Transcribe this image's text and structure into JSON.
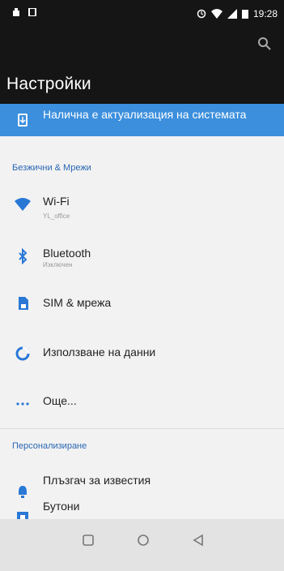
{
  "status": {
    "time": "19:28"
  },
  "header": {
    "title": "Настройки"
  },
  "banner": {
    "text": "Налична е актуализация на системата"
  },
  "sections": {
    "wireless": "Безжични & Мрежи",
    "personal": "Персонализиране"
  },
  "items": {
    "wifi": {
      "label": "Wi-Fi",
      "sub": "YL_office"
    },
    "bluetooth": {
      "label": "Bluetooth",
      "sub": "Изключен"
    },
    "sim": {
      "label": "SIM & мрежа"
    },
    "data": {
      "label": "Използване на данни"
    },
    "more": {
      "label": "Още..."
    },
    "notif": {
      "label": "Плъзгач за известия"
    },
    "buttons": {
      "label": "Бутони"
    }
  },
  "colors": {
    "accent": "#3b8fdd",
    "section": "#2a67b3",
    "icon": "#2a78d6"
  },
  "icons": [
    "search-icon",
    "system-update-icon",
    "wifi-icon",
    "bluetooth-icon",
    "sim-icon",
    "data-usage-icon",
    "more-icon",
    "notification-icon",
    "buttons-icon",
    "recents-icon",
    "home-icon",
    "back-icon"
  ]
}
